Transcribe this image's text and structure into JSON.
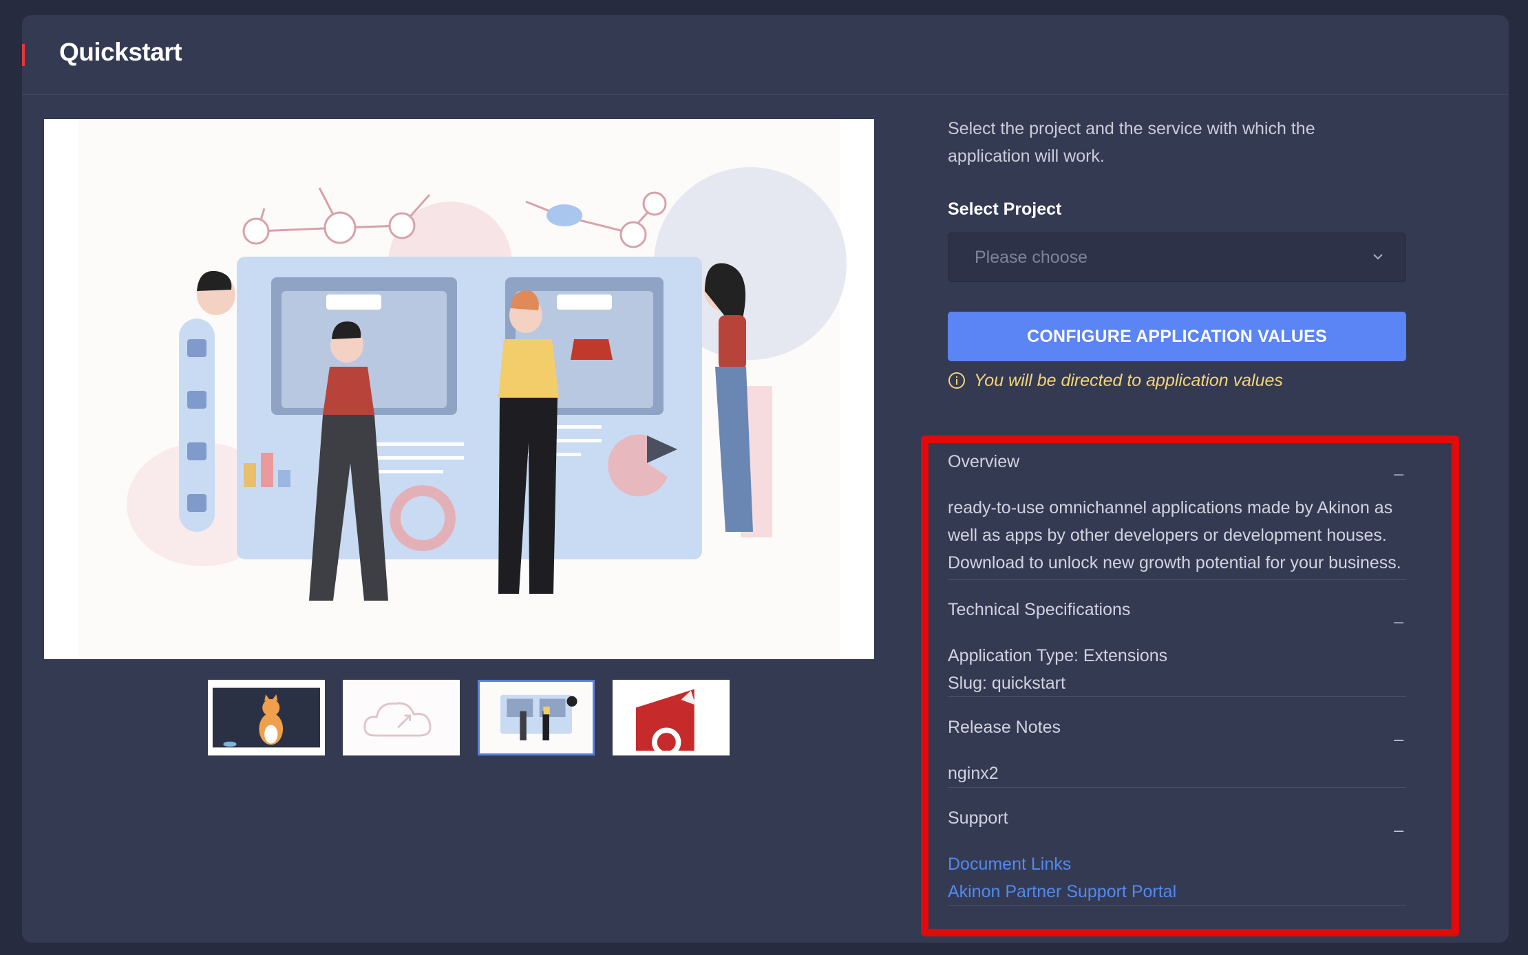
{
  "header": {
    "title": "Quickstart"
  },
  "intro": {
    "text": "Select the project and the service with which the application will work."
  },
  "select_project": {
    "label": "Select Project",
    "placeholder": "Please choose"
  },
  "configure": {
    "button_label": "CONFIGURE APPLICATION VALUES",
    "info_text": "You will be directed to application values"
  },
  "accordion": {
    "overview": {
      "title": "Overview",
      "toggle": "_",
      "body": "ready-to-use omnichannel applications made by Akinon as well as apps by other developers or development houses. Download to unlock new growth potential for your business."
    },
    "technical": {
      "title": "Technical Specifications",
      "toggle": "_",
      "app_type": "Application Type: Extensions",
      "slug": "Slug: quickstart"
    },
    "release_notes": {
      "title": "Release Notes",
      "toggle": "_",
      "body": "nginx2"
    },
    "support": {
      "title": "Support",
      "toggle": "_",
      "links": [
        "Document Links",
        "Akinon Partner Support Portal"
      ]
    }
  },
  "colors": {
    "accent": "#e23a3a",
    "primary_button": "#5b84f5",
    "link": "#4f8bf0",
    "info_text": "#f2d57a",
    "highlight_border": "#e20a0a"
  },
  "icons": [
    "chevron-down-icon",
    "info-icon"
  ],
  "gallery": {
    "thumbnail_count": 4,
    "selected_index": 3
  }
}
